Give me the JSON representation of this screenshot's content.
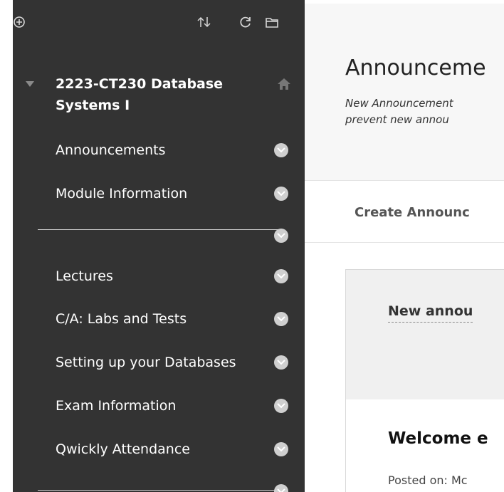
{
  "toolbar": {
    "icons": [
      "add-icon",
      "sort-icon",
      "refresh-icon",
      "folder-icon"
    ]
  },
  "sidebar": {
    "course_title_line1": "2223-CT230 Database",
    "course_title_line2": "Systems I",
    "items": [
      {
        "label": "Announcements"
      },
      {
        "label": "Module Information"
      },
      {
        "label": "Lectures"
      },
      {
        "label": "C/A: Labs and Tests"
      },
      {
        "label": "Setting up your Databases"
      },
      {
        "label": "Exam Information"
      },
      {
        "label": "Qwickly Attendance"
      }
    ]
  },
  "main": {
    "title": "Announceme",
    "subtitle_line1": "New Announcement",
    "subtitle_line2": "prevent new annou",
    "create_button": "Create Announc",
    "new_announcement": "New annou",
    "welcome": "Welcome e",
    "posted_on": "Posted on: Mc"
  },
  "colors": {
    "sidebar_bg": "#333333",
    "chevron_circle": "#cfcfcf",
    "header_band": "#f7f7f7"
  }
}
